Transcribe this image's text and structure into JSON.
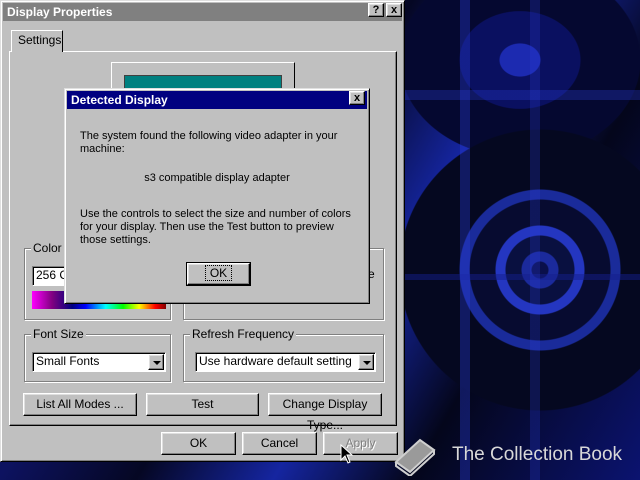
{
  "main_window": {
    "title": "Display Properties",
    "help_btn": "?",
    "close_btn": "x",
    "tab_settings": "Settings",
    "color_palette": {
      "label": "Color P",
      "value": "256 C"
    },
    "desktop_area": {
      "visible_suffix": "e"
    },
    "font_size": {
      "label": "Font Size",
      "value": "Small Fonts"
    },
    "refresh": {
      "label": "Refresh Frequency",
      "value": "Use hardware default setting"
    },
    "list_all_modes": "List All Modes ...",
    "test": "Test",
    "change_display_type": "Change Display Type...",
    "ok": "OK",
    "cancel": "Cancel",
    "apply": "Apply"
  },
  "dialog": {
    "title": "Detected Display",
    "close_btn": "x",
    "line1": "The system found the following video adapter in your",
    "line2": "machine:",
    "adapter": "s3 compatible display adapter",
    "instr1": "Use the controls to select the size and number of colors",
    "instr2": "for your display.  Then use the Test button to preview",
    "instr3": "those settings.",
    "ok": "OK"
  },
  "watermark": {
    "text": "The Collection Book"
  },
  "colors": {
    "titlebar": "#000080",
    "face": "#c0c0c0",
    "desktop": "#06081e"
  }
}
